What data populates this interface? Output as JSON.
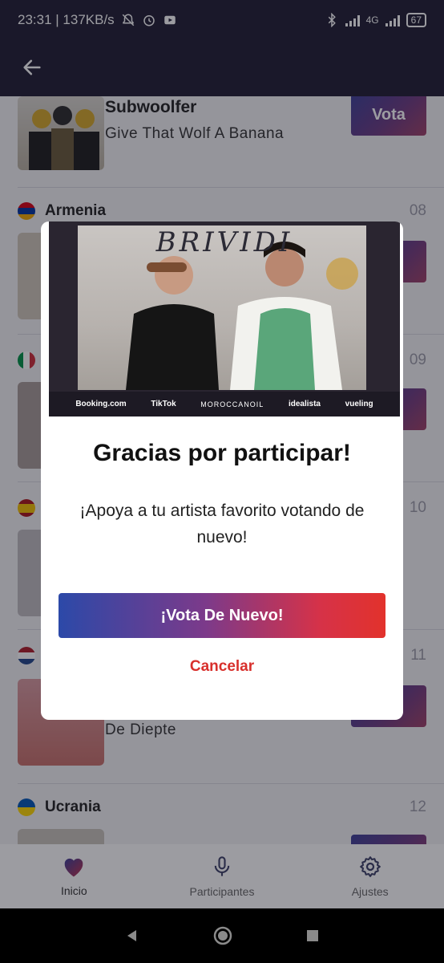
{
  "status_bar": {
    "time_speed": "23:31 | 137KB/s",
    "network": "4G",
    "battery": "67"
  },
  "list": {
    "entries": [
      {
        "country": "",
        "order": "",
        "artist": "Subwoolfer",
        "song": "Give That Wolf A Banana",
        "vote_label": "Vota"
      },
      {
        "country": "Armenia",
        "order": "08"
      },
      {
        "country": "",
        "order": "09"
      },
      {
        "country": "",
        "order": "10"
      },
      {
        "country": "",
        "order": "11",
        "song": "De Diepte"
      },
      {
        "country": "Ucrania",
        "order": "12"
      }
    ]
  },
  "modal": {
    "banner_title": "BRIVIDI",
    "sponsors": [
      "Booking.com",
      "TikTok",
      "MOROCCANOIL",
      "idealista",
      "vueling"
    ],
    "title": "Gracias por participar!",
    "body": "¡Apoya a tu artista favorito votando de nuevo!",
    "primary_button": "¡Vota De Nuevo!",
    "cancel": "Cancelar"
  },
  "bottom_nav": {
    "items": [
      {
        "label": "Inicio",
        "icon": "heart-icon",
        "active": true
      },
      {
        "label": "Participantes",
        "icon": "microphone-icon",
        "active": false
      },
      {
        "label": "Ajustes",
        "icon": "gear-icon",
        "active": false
      }
    ]
  },
  "colors": {
    "header": "#1f1d33",
    "accent_red": "#d8302c",
    "accent_blue": "#2c49a8"
  }
}
